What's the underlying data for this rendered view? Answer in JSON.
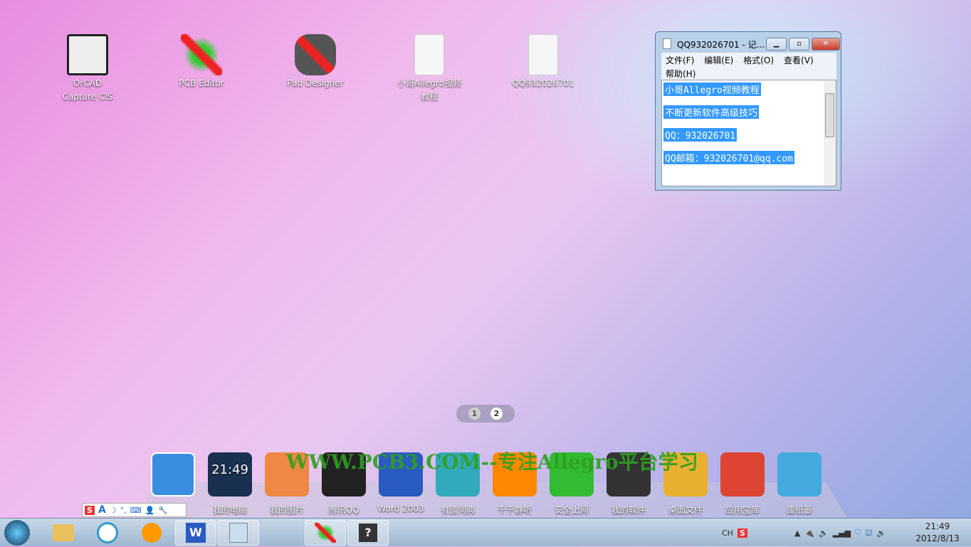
{
  "desktop_icons": [
    {
      "label": "OrCAD Capture CIS",
      "icon": "orcad-icon"
    },
    {
      "label": "PCB Editor",
      "icon": "pcb-editor-icon"
    },
    {
      "label": "Pad Designer",
      "icon": "pad-designer-icon"
    },
    {
      "label": "小哥Allegro视频教程",
      "icon": "text-file-icon"
    },
    {
      "label": "QQ932026701",
      "icon": "text-file-icon"
    }
  ],
  "notepad": {
    "title": "QQ932026701 - 记...",
    "menu": [
      "文件(F)",
      "编辑(E)",
      "格式(O)",
      "查看(V)",
      "帮助(H)"
    ],
    "lines": [
      "小哥Allegro视频教程",
      "不断更新软件高级技巧",
      "QQ：932026701",
      "QQ邮箱：932026701@qq.com"
    ]
  },
  "pager": {
    "pages": [
      "1",
      "2"
    ],
    "current": "2"
  },
  "watermark": "WWW.PCB3.COM--专注Allegro平台学习",
  "dock": [
    {
      "label": "",
      "icon": "user-icon",
      "color": "#3a8ee0"
    },
    {
      "label": "我的电脑",
      "icon": "monitor-clock-icon",
      "clock": "21:49",
      "color": "#1a3050"
    },
    {
      "label": "我的图片",
      "icon": "pictures-icon",
      "color": "#e84"
    },
    {
      "label": "腾讯QQ",
      "icon": "qq-penguin-icon",
      "color": "#222"
    },
    {
      "label": "Word 2003",
      "icon": "word-icon",
      "color": "#2a5bc0"
    },
    {
      "label": "有道词典",
      "icon": "dictionary-icon",
      "color": "#3ab"
    },
    {
      "label": "千千静听",
      "icon": "music-player-icon",
      "color": "#f80"
    },
    {
      "label": "安全上网",
      "icon": "ie-icon",
      "color": "#3b3"
    },
    {
      "label": "我的软件",
      "icon": "software-folder-icon",
      "color": "#333"
    },
    {
      "label": "桌面文件",
      "icon": "desktop-files-icon",
      "color": "#e9b030"
    },
    {
      "label": "应用宝库",
      "icon": "app-store-icon",
      "color": "#d43"
    },
    {
      "label": "废纸篓",
      "icon": "recycle-bin-icon",
      "color": "#4ad"
    }
  ],
  "taskbar": {
    "tray_lang": "CH",
    "time": "21:49",
    "date": "2012/8/13"
  },
  "colors": {
    "selection": "#3399ff",
    "watermark": "#2ea020"
  }
}
